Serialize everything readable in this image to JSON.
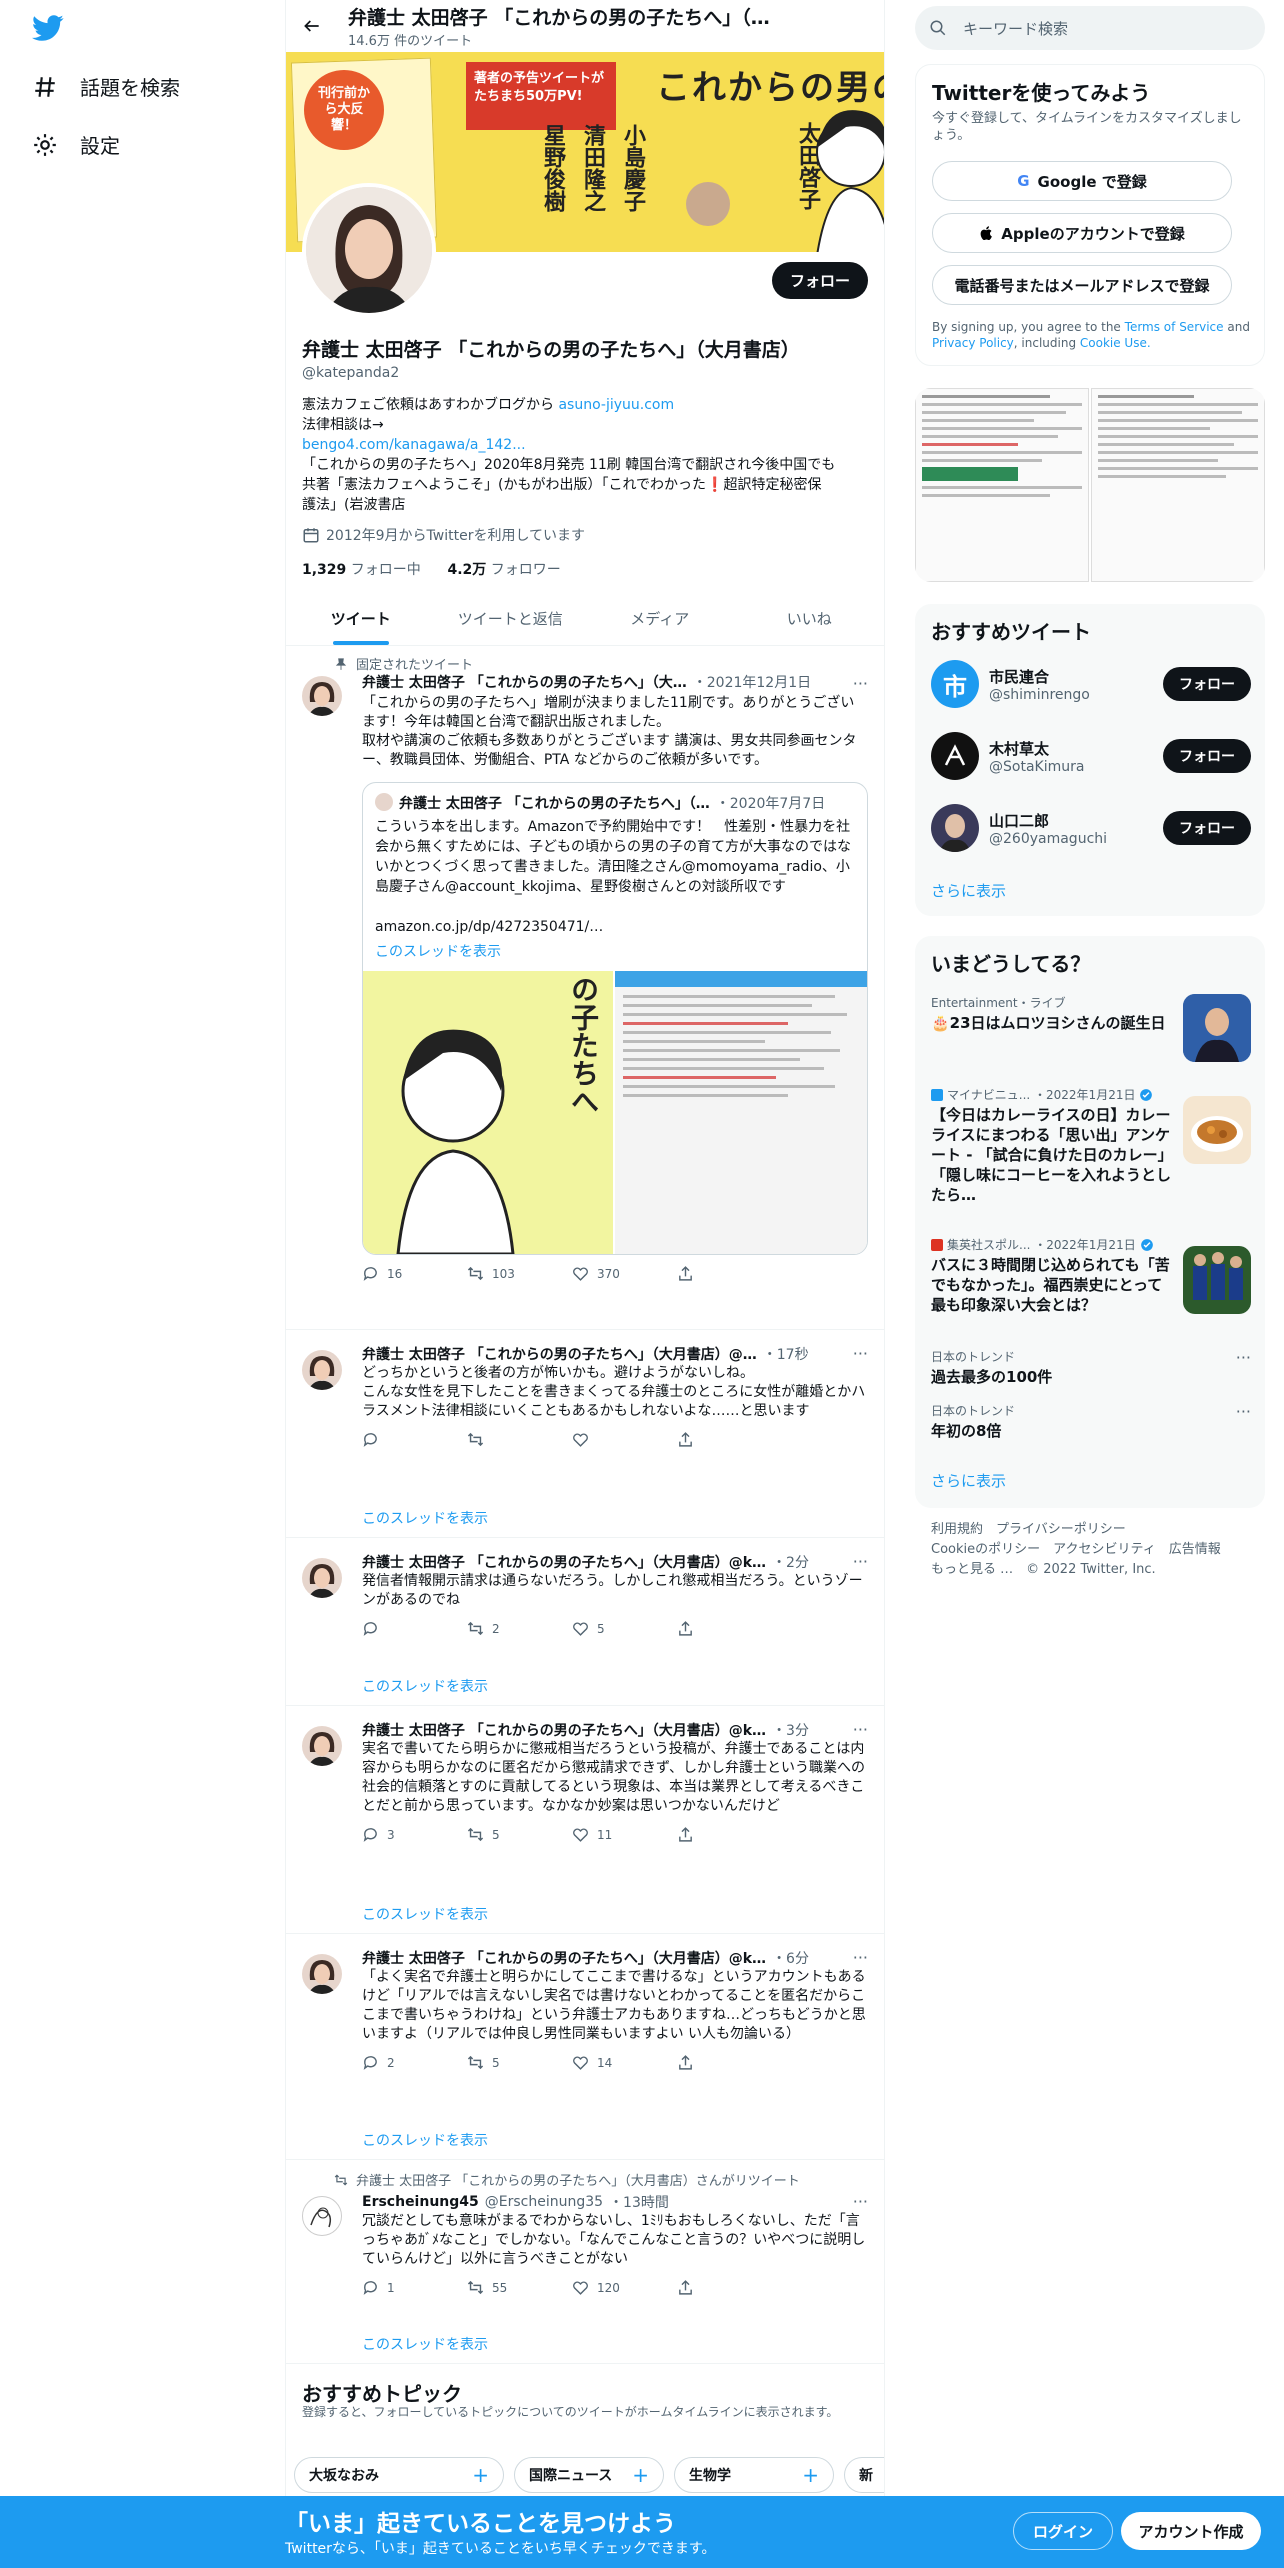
{
  "nav": {
    "explore": "話題を検索",
    "settings": "設定"
  },
  "header": {
    "title": "弁護士 太田啓子 「これからの男の子たちへ」（…",
    "tweet_count": "14.6万 件のツイート"
  },
  "banner": {
    "main_title": "これからの男の子たちへ",
    "badge1": "刊行前から大反響！",
    "badge2": "著者の予告ツイートがたちまち50万PV!",
    "authors": [
      "太田啓子",
      "小島慶子",
      "清田隆之",
      "星野俊樹"
    ]
  },
  "profile": {
    "follow_label": "フォロー",
    "name": "弁護士 太田啓子 「これからの男の子たちへ」（大月書店）",
    "handle": "@katepanda2",
    "bio_line1": "憲法カフェご依頼はあすわかブログから",
    "bio_link1": "asuno-jiyuu.com",
    "bio_line2": "法律相談は→",
    "bio_link2": "bengo4.com/kanagawa/a_142...",
    "bio_line3": "「これからの男の子たちへ」2020年8月発売 11刷 韓国台湾で翻訳され今後中国でも",
    "bio_line4": "共著「憲法カフェへようこそ」(かもがわ出版）「これでわかった❗超訳特定秘密保",
    "bio_line5": "護法」(岩波書店",
    "joined": "2012年9月からTwitterを利用しています",
    "following_count": "1,329",
    "following_label": "フォロー中",
    "followers_count": "4.2万",
    "followers_label": "フォロワー"
  },
  "tabs": [
    "ツイート",
    "ツイートと返信",
    "メディア",
    "いいね"
  ],
  "pinned_label": "固定されたツイート",
  "tweets": [
    {
      "name": "弁護士 太田啓子 「これからの男の子たちへ」（大…",
      "time": "・2021年12月1日",
      "text": "「これからの男の子たちへ」増刷が決まりました11刷です。ありがとうございます！今年は韓国と台湾で翻訳出版されました。\n取材や講演のご依頼も多数ありがとうございます 講演は、男女共同参画センター、教職員団体、労働組合、PTA などからのご依頼が多いです。",
      "reply": "16",
      "retweet": "103",
      "like": "370"
    },
    {
      "name": "弁護士 太田啓子 「これからの男の子たちへ」（大月書店）@…",
      "time": "・17秒",
      "text": "どっちかというと後者の方が怖いかも。避けようがないしね。\nこんな女性を見下したことを書きまくってる弁護士のところに女性が離婚とかハラスメント法律相談にいくこともあるかもしれないよな……と思います",
      "reply": "",
      "retweet": "",
      "like": ""
    },
    {
      "name": "弁護士 太田啓子 「これからの男の子たちへ」（大月書店）@k…",
      "time": "・2分",
      "text": "発信者情報開示請求は通らないだろう。しかしこれ懲戒相当だろう。というゾーンがあるのでね",
      "reply": "",
      "retweet": "2",
      "like": "5"
    },
    {
      "name": "弁護士 太田啓子 「これからの男の子たちへ」（大月書店）@k…",
      "time": "・3分",
      "text": "実名で書いてたら明らかに懲戒相当だろうという投稿が、弁護士であることは内容からも明らかなのに匿名だから懲戒請求できず、しかし弁護士という職業への社会的信頼落とすのに貢献してるという現象は、本当は業界として考えるべきことだと前から思っています。なかなか妙案は思いつかないんだけど",
      "reply": "3",
      "retweet": "5",
      "like": "11"
    },
    {
      "name": "弁護士 太田啓子 「これからの男の子たちへ」（大月書店）@k…",
      "time": "・6分",
      "text": "「よく実名で弁護士と明らかにしてここまで書けるな」というアカウントもあるけど「リアルでは言えないし実名では書けないとわかってることを匿名だからここまで書いちゃうわけね」という弁護士アカもありますね…どっちもどうかと思いますよ（リアルでは仲良し男性同業もいますよい い人も勿論いる）",
      "reply": "2",
      "retweet": "5",
      "like": "14"
    },
    {
      "retweeted_by": "弁護士 太田啓子 「これからの男の子たちへ」（大月書店）さんがリツイート",
      "name": "Erscheinung45",
      "handle": "@Erscheinung35",
      "time": "・13時間",
      "text": "冗談だとしても意味がまるでわからないし、1ﾐﾘもおもしろくないし、ただ「言っちゃあｶﾞﾒなこと」でしかない。「なんでこんなこと言うの？いやべつに説明していらんけど」以外に言うべきことがない",
      "reply": "1",
      "retweet": "55",
      "like": "120"
    }
  ],
  "quote": {
    "name": "弁護士 太田啓子 「これからの男の子たちへ」（…",
    "time": "・2020年7月7日",
    "text": "こういう本を出します。Amazonで予約開始中です！　性差別・性暴力を社会から無くすためには、子どもの頃からの男の子の育て方が大事なのではないかとつくづく思って書きました。清田隆之さん@momoyama_radio、小島慶子さん@account_kkojima、星野俊樹さんとの対談所収です\n\namazon.co.jp/dp/4272350471/…",
    "show_thread": "このスレッドを表示",
    "cover_text": "の子たちへ"
  },
  "show_thread": "このスレッドを表示",
  "topics": {
    "title": "おすすめトピック",
    "sub": "登録すると、フォローしているトピックについてのツイートがホームタイムラインに表示されます。",
    "chips": [
      "大坂なおみ",
      "国際ニュース",
      "生物学",
      "新"
    ]
  },
  "search": {
    "placeholder": "キーワード検索"
  },
  "signup": {
    "title": "Twitterを使ってみよう",
    "sub": "今すぐ登録して、タイムラインをカスタマイズしましょう。",
    "google": "Google で登録",
    "apple": "Appleのアカウントで登録",
    "phone": "電話番号またはメールアドレスで登録",
    "terms_pre": "By signing up, you agree to the",
    "terms_link": "Terms of Service",
    "terms_and": "and",
    "privacy_link": "Privacy Policy",
    "including": ", including",
    "cookie_link": "Cookie Use."
  },
  "recommended": {
    "title": "おすすめツイート",
    "users": [
      {
        "name": "市民連合",
        "handle": "@shiminrengo",
        "btn": "フォロー",
        "color": "#1d9bf0"
      },
      {
        "name": "木村草太",
        "handle": "@SotaKimura",
        "btn": "フォロー",
        "color": "#111111"
      },
      {
        "name": "山口二郎",
        "handle": "@260yamaguchi",
        "btn": "フォロー",
        "color": "#3a3a5a"
      }
    ],
    "more": "さらに表示"
  },
  "trends": {
    "title": "いまどうしてる？",
    "items": [
      {
        "cat": "Entertainment・ライブ",
        "title": "🎂23日はムロツヨシさんの誕生日"
      },
      {
        "cat": "マイナビニュ... ・2022年1月21日",
        "title": "【今日はカレーライスの日】カレーライスにまつわる「思い出」アンケート - 「試合に負けた日のカレー」「隠し味にコーヒーを入れようとしたら…"
      },
      {
        "cat": "集英社スポル... ・2022年1月21日",
        "title": "バスに３時間閉じ込められても「苦でもなかった」。福西崇史にとって最も印象深い大会とは？"
      },
      {
        "cat": "日本のトレンド",
        "title": "過去最多の100件"
      },
      {
        "cat": "日本のトレンド",
        "title": "年初の8倍"
      }
    ],
    "more": "さらに表示"
  },
  "footer": {
    "links1": "利用規約　プライバシーポリシー",
    "links2": "Cookieのポリシー　アクセシビリティ　広告情報",
    "links3": "もっと見る …　© 2022 Twitter, Inc."
  },
  "bottombar": {
    "big": "「いま」起きていることを見つけよう",
    "small": "Twitterなら、「いま」起きていることをいち早くチェックできます。",
    "login": "ログイン",
    "signup": "アカウント作成"
  },
  "colors": {
    "accent": "#1d9bf0",
    "text": "#0f1419",
    "muted": "#536471"
  }
}
